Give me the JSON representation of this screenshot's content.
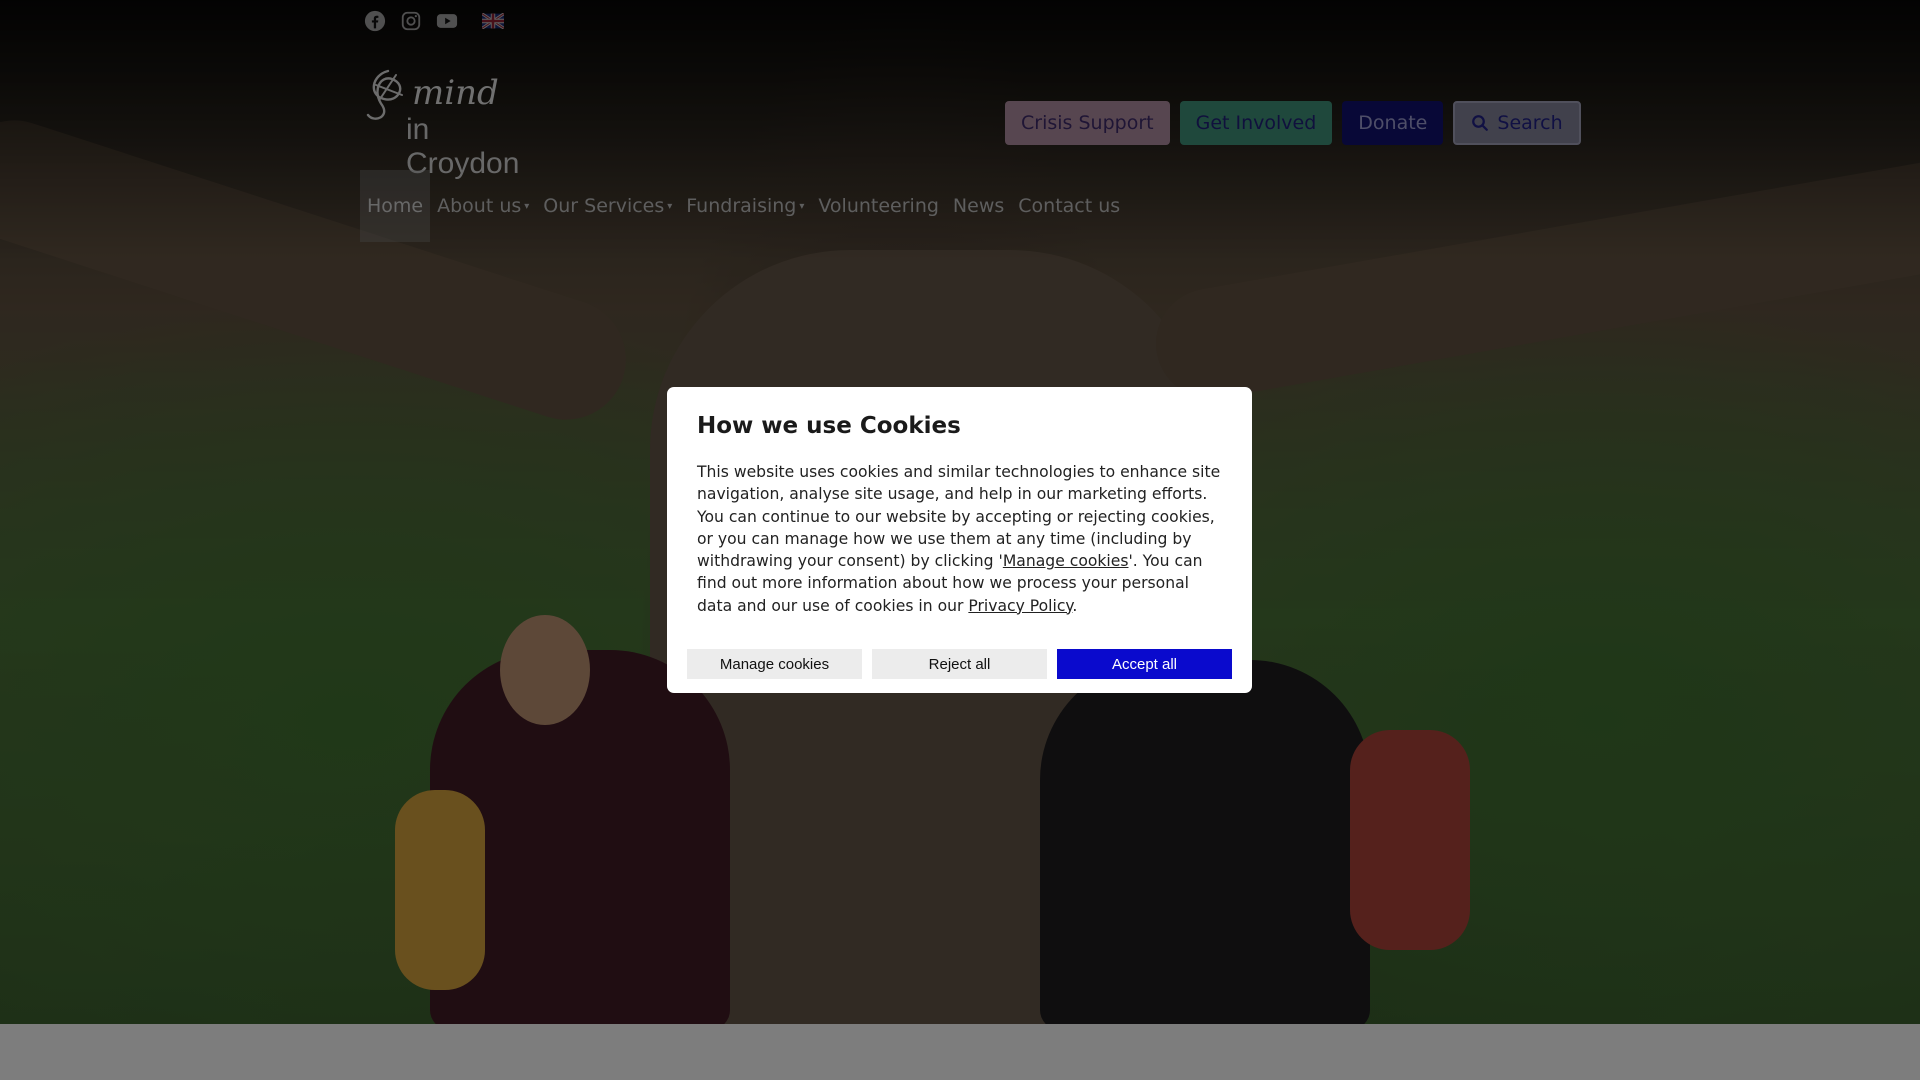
{
  "social": {
    "icons": [
      "facebook-icon",
      "instagram-icon",
      "youtube-icon",
      "uk-flag-icon"
    ]
  },
  "brand": {
    "line1": "mind",
    "line2": "in Croydon"
  },
  "header_actions": {
    "crisis": "Crisis Support",
    "involved": "Get Involved",
    "donate": "Donate",
    "search": "Search"
  },
  "nav": {
    "items": [
      {
        "label": "Home"
      },
      {
        "label": "About us"
      },
      {
        "label": "Our Services"
      },
      {
        "label": "Fundraising"
      },
      {
        "label": "Volunteering"
      },
      {
        "label": "News"
      },
      {
        "label": "Contact us"
      }
    ]
  },
  "cookie_modal": {
    "title": "How we use Cookies",
    "text_part1": "This website uses cookies and similar technologies to enhance site navigation, analyse site usage, and help in our marketing efforts. You can continue to our website by accepting or rejecting cookies, or you can manage how we use them at any time (including by withdrawing your consent) by clicking '",
    "manage_link": "Manage cookies",
    "text_part2": "'. You can find out more information about how we process your personal data and our use of cookies in our ",
    "privacy_link": "Privacy Policy",
    "text_part3": ".",
    "buttons": {
      "manage": "Manage cookies",
      "reject": "Reject all",
      "accept": "Accept all"
    }
  },
  "colors": {
    "accept": "#0a0acd",
    "donate": "#10106a",
    "involved": "#3c8a73",
    "crisis": "#a8869a"
  }
}
